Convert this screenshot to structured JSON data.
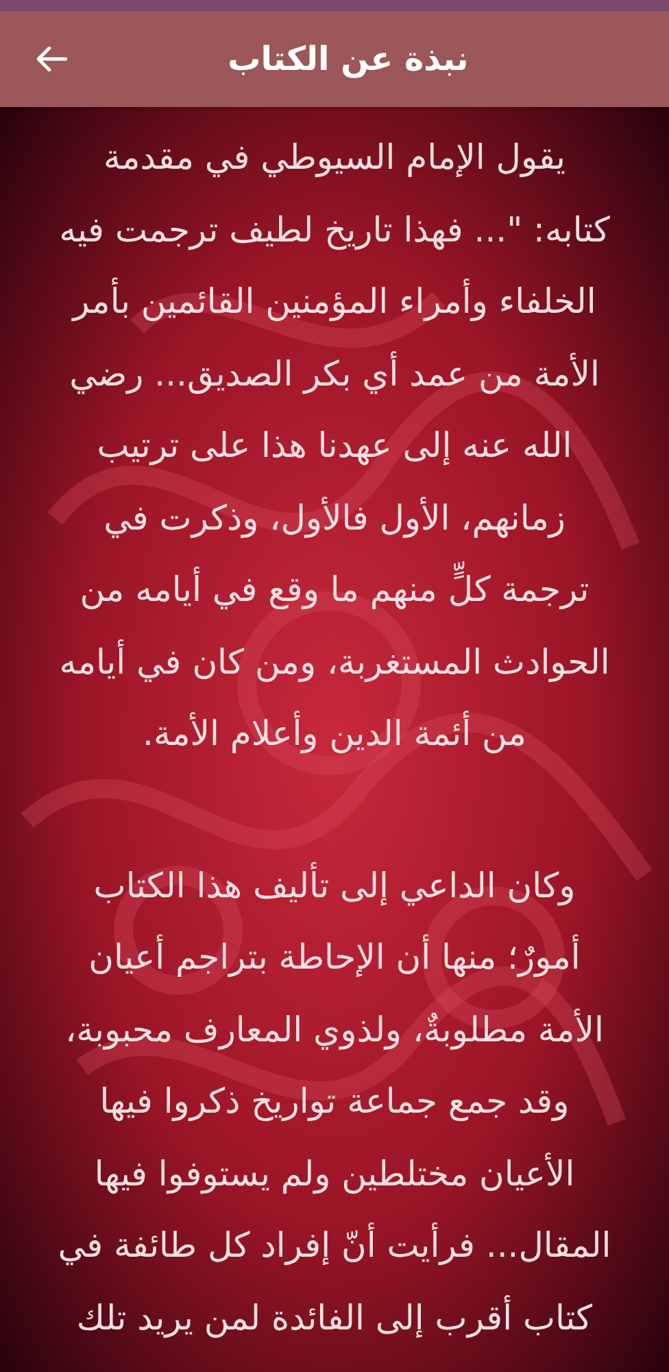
{
  "app_bar": {
    "title": "نبذة عن الكتاب"
  },
  "paragraphs": [
    {
      "lines": [
        "يقول الإمام السيوطي في مقدمة",
        "كتابه: \"... فهذا تاريخ لطيف ترجمت فيه",
        "الخلفاء وأمراء المؤمنين القائمين بأمر",
        "الأمة من عمد أي بكر الصديق... رضي",
        "الله عنه إلى عهدنا هذا على ترتيب",
        "زمانهم، الأول فالأول، وذكرت في",
        "ترجمة كلٍّ منهم ما وقع في أيامه من",
        "الحوادث المستغربة، ومن كان في أيامه",
        "من أئمة الدين وأعلام الأمة."
      ]
    },
    {
      "lines": [
        "وكان الداعي إلى تأليف هذا الكتاب",
        "أمورٌ؛ منها أن الإحاطة بتراجم أعيان",
        "الأمة مطلوبةٌ، ولذوي المعارف محبوبة،",
        "وقد جمع جماعة تواريخ ذكروا فيها",
        "الأعيان مختلطين ولم يستوفوا فيها",
        "المقال... فرأيت أنّ إفراد كل طائفة في",
        "كتاب أقرب إلى الفائدة لمن يريد تلك"
      ]
    }
  ]
}
